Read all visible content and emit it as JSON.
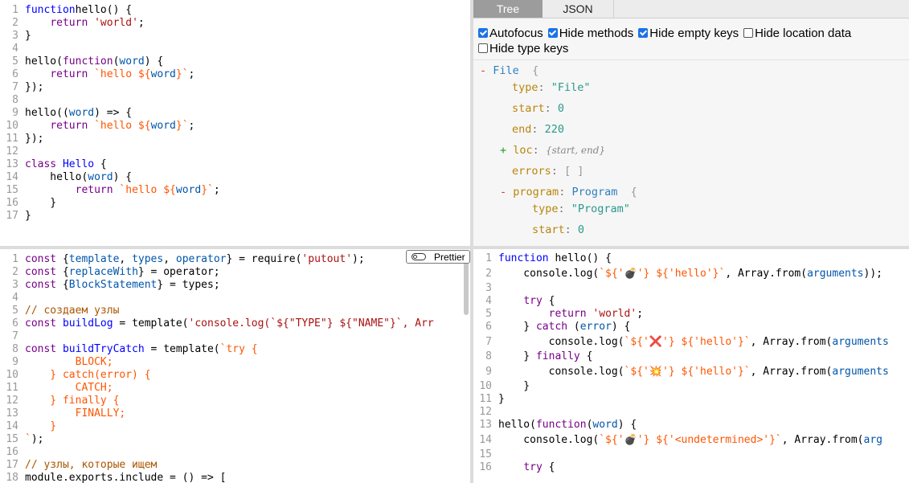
{
  "source": {
    "lines": [
      [
        [
          "def",
          "function"
        ],
        [
          "",
          "hello() {"
        ]
      ],
      [
        [
          "",
          "    "
        ],
        [
          "kw",
          "return"
        ],
        [
          "",
          ""
        ],
        [
          "str",
          " 'world'"
        ],
        [
          "",
          ";"
        ]
      ],
      [
        [
          "",
          "}"
        ]
      ],
      [
        [
          "",
          ""
        ]
      ],
      [
        [
          "",
          "hello("
        ],
        [
          "kw",
          "function"
        ],
        [
          "",
          "("
        ],
        [
          "var2",
          "word"
        ],
        [
          "",
          ") {"
        ]
      ],
      [
        [
          "",
          "    "
        ],
        [
          "kw",
          "return"
        ],
        [
          "str2",
          " `hello ${"
        ],
        [
          "var2",
          "word"
        ],
        [
          "str2",
          "}`"
        ],
        [
          "",
          ";"
        ]
      ],
      [
        [
          "",
          "});"
        ]
      ],
      [
        [
          "",
          ""
        ]
      ],
      [
        [
          "",
          "hello(("
        ],
        [
          "var2",
          "word"
        ],
        [
          "",
          ") => {"
        ]
      ],
      [
        [
          "",
          "    "
        ],
        [
          "kw",
          "return"
        ],
        [
          "str2",
          " `hello ${"
        ],
        [
          "var2",
          "word"
        ],
        [
          "str2",
          "}`"
        ],
        [
          "",
          ";"
        ]
      ],
      [
        [
          "",
          "});"
        ]
      ],
      [
        [
          "",
          ""
        ]
      ],
      [
        [
          "kw",
          "class"
        ],
        [
          "def",
          " Hello"
        ],
        [
          "",
          " {"
        ]
      ],
      [
        [
          "",
          "    hello("
        ],
        [
          "var2",
          "word"
        ],
        [
          "",
          ") {"
        ]
      ],
      [
        [
          "",
          "        "
        ],
        [
          "kw",
          "return"
        ],
        [
          "str2",
          " `hello ${"
        ],
        [
          "var2",
          "word"
        ],
        [
          "str2",
          "}`"
        ],
        [
          "",
          ";"
        ]
      ],
      [
        [
          "",
          "    }"
        ]
      ],
      [
        [
          "",
          "}"
        ]
      ]
    ]
  },
  "ast": {
    "tabs": [
      "Tree",
      "JSON"
    ],
    "options": [
      {
        "label": "Autofocus",
        "checked": true
      },
      {
        "label": "Hide methods",
        "checked": true
      },
      {
        "label": "Hide empty keys",
        "checked": true
      },
      {
        "label": "Hide location data",
        "checked": false
      },
      {
        "label": "Hide type keys",
        "checked": false
      }
    ],
    "tree": {
      "root_toggle": "-",
      "root_name": "File",
      "open_brace": "{",
      "type_key": "type",
      "type_val": "\"File\"",
      "start_key": "start",
      "start_val": "0",
      "end_key": "end",
      "end_val": "220",
      "loc_toggle": "+",
      "loc_key": "loc",
      "loc_summary": "{start, end}",
      "errors_key": "errors",
      "errors_val": "[ ]",
      "program_toggle": "-",
      "program_key": "program",
      "program_name": "Program",
      "program_brace": "{",
      "ptype_key": "type",
      "ptype_val": "\"Program\"",
      "pstart_key": "start",
      "pstart_val": "0"
    }
  },
  "prettier": {
    "label": "Prettier",
    "enabled": false
  },
  "transform": {
    "lines": [
      [
        [
          "kw",
          "const"
        ],
        [
          "",
          " {"
        ],
        [
          "var2",
          "template"
        ],
        [
          "",
          ", "
        ],
        [
          "var2",
          "types"
        ],
        [
          "",
          ", "
        ],
        [
          "var2",
          "operator"
        ],
        [
          "",
          "} = require("
        ],
        [
          "str",
          "'putout'"
        ],
        [
          "",
          ");"
        ]
      ],
      [
        [
          "kw",
          "const"
        ],
        [
          "",
          " {"
        ],
        [
          "var2",
          "replaceWith"
        ],
        [
          "",
          "} = operator;"
        ]
      ],
      [
        [
          "kw",
          "const"
        ],
        [
          "",
          " {"
        ],
        [
          "var2",
          "BlockStatement"
        ],
        [
          "",
          "} = types;"
        ]
      ],
      [
        [
          "",
          ""
        ]
      ],
      [
        [
          "cm",
          "// создаем узлы"
        ]
      ],
      [
        [
          "kw",
          "const"
        ],
        [
          "def",
          " buildLog"
        ],
        [
          "",
          " = template("
        ],
        [
          "str",
          "'console.log(`${\"TYPE\"} ${\"NAME\"}`, Arr"
        ]
      ],
      [
        [
          "",
          ""
        ]
      ],
      [
        [
          "kw",
          "const"
        ],
        [
          "def",
          " buildTryCatch"
        ],
        [
          "",
          " = template("
        ],
        [
          "str2",
          "`try {"
        ]
      ],
      [
        [
          "str2",
          "        BLOCK;"
        ]
      ],
      [
        [
          "str2",
          "    } catch(error) {"
        ]
      ],
      [
        [
          "str2",
          "        CATCH;"
        ]
      ],
      [
        [
          "str2",
          "    } finally {"
        ]
      ],
      [
        [
          "str2",
          "        FINALLY;"
        ]
      ],
      [
        [
          "str2",
          "    }"
        ]
      ],
      [
        [
          "str2",
          "`"
        ],
        [
          "",
          ");"
        ]
      ],
      [
        [
          "",
          ""
        ]
      ],
      [
        [
          "cm",
          "// узлы, которые ищем"
        ]
      ],
      [
        [
          "",
          "module.exports.include = () => ["
        ]
      ]
    ]
  },
  "output": {
    "lines": [
      {
        "n": "1",
        "e": false,
        "p": [
          [
            "def",
            "function"
          ],
          [
            "",
            " hello() {"
          ]
        ]
      },
      {
        "n": "2",
        "e": true,
        "p": [
          [
            "",
            "    console.log("
          ],
          [
            "str2",
            "`${'"
          ],
          [
            "emo",
            "💣"
          ],
          [
            "str2",
            "'} ${'hello'}`"
          ],
          [
            "",
            ", Array.from("
          ],
          [
            "var2",
            "arguments"
          ],
          [
            "",
            "));"
          ]
        ]
      },
      {
        "n": "3",
        "e": false,
        "p": [
          [
            "",
            ""
          ]
        ]
      },
      {
        "n": "4",
        "e": false,
        "p": [
          [
            "",
            "    "
          ],
          [
            "kw",
            "try"
          ],
          [
            "",
            " {"
          ]
        ]
      },
      {
        "n": "5",
        "e": false,
        "p": [
          [
            "",
            "        "
          ],
          [
            "kw",
            "return"
          ],
          [
            "str",
            " 'world'"
          ],
          [
            "",
            ";"
          ]
        ]
      },
      {
        "n": "6",
        "e": false,
        "p": [
          [
            "",
            "    } "
          ],
          [
            "kw",
            "catch"
          ],
          [
            "",
            " ("
          ],
          [
            "var2",
            "error"
          ],
          [
            "",
            ") {"
          ]
        ]
      },
      {
        "n": "7",
        "e": true,
        "p": [
          [
            "",
            "        console.log("
          ],
          [
            "str2",
            "`${'"
          ],
          [
            "emo",
            "❌"
          ],
          [
            "str2",
            "'} ${'hello'}`"
          ],
          [
            "",
            ", Array.from("
          ],
          [
            "var2",
            "arguments"
          ]
        ]
      },
      {
        "n": "8",
        "e": false,
        "p": [
          [
            "",
            "    } "
          ],
          [
            "kw",
            "finally"
          ],
          [
            "",
            " {"
          ]
        ]
      },
      {
        "n": "9",
        "e": true,
        "p": [
          [
            "",
            "        console.log("
          ],
          [
            "str2",
            "`${'"
          ],
          [
            "emo",
            "💥"
          ],
          [
            "str2",
            "'} ${'hello'}`"
          ],
          [
            "",
            ", Array.from("
          ],
          [
            "var2",
            "arguments"
          ]
        ]
      },
      {
        "n": "10",
        "e": false,
        "p": [
          [
            "",
            "    }"
          ]
        ]
      },
      {
        "n": "11",
        "e": false,
        "p": [
          [
            "",
            "}"
          ]
        ]
      },
      {
        "n": "12",
        "e": false,
        "p": [
          [
            "",
            ""
          ]
        ]
      },
      {
        "n": "13",
        "e": false,
        "p": [
          [
            "",
            "hello("
          ],
          [
            "kw",
            "function"
          ],
          [
            "",
            "("
          ],
          [
            "var2",
            "word"
          ],
          [
            "",
            ") {"
          ]
        ]
      },
      {
        "n": "14",
        "e": true,
        "p": [
          [
            "",
            "    console.log("
          ],
          [
            "str2",
            "`${'"
          ],
          [
            "emo",
            "💣"
          ],
          [
            "str2",
            "'} ${'<undetermined>'}`"
          ],
          [
            "",
            ", Array.from("
          ],
          [
            "var2",
            "arg"
          ]
        ]
      },
      {
        "n": "15",
        "e": false,
        "p": [
          [
            "",
            ""
          ]
        ]
      },
      {
        "n": "16",
        "e": false,
        "p": [
          [
            "",
            "    "
          ],
          [
            "kw",
            "try"
          ],
          [
            "",
            " {"
          ]
        ]
      }
    ]
  }
}
